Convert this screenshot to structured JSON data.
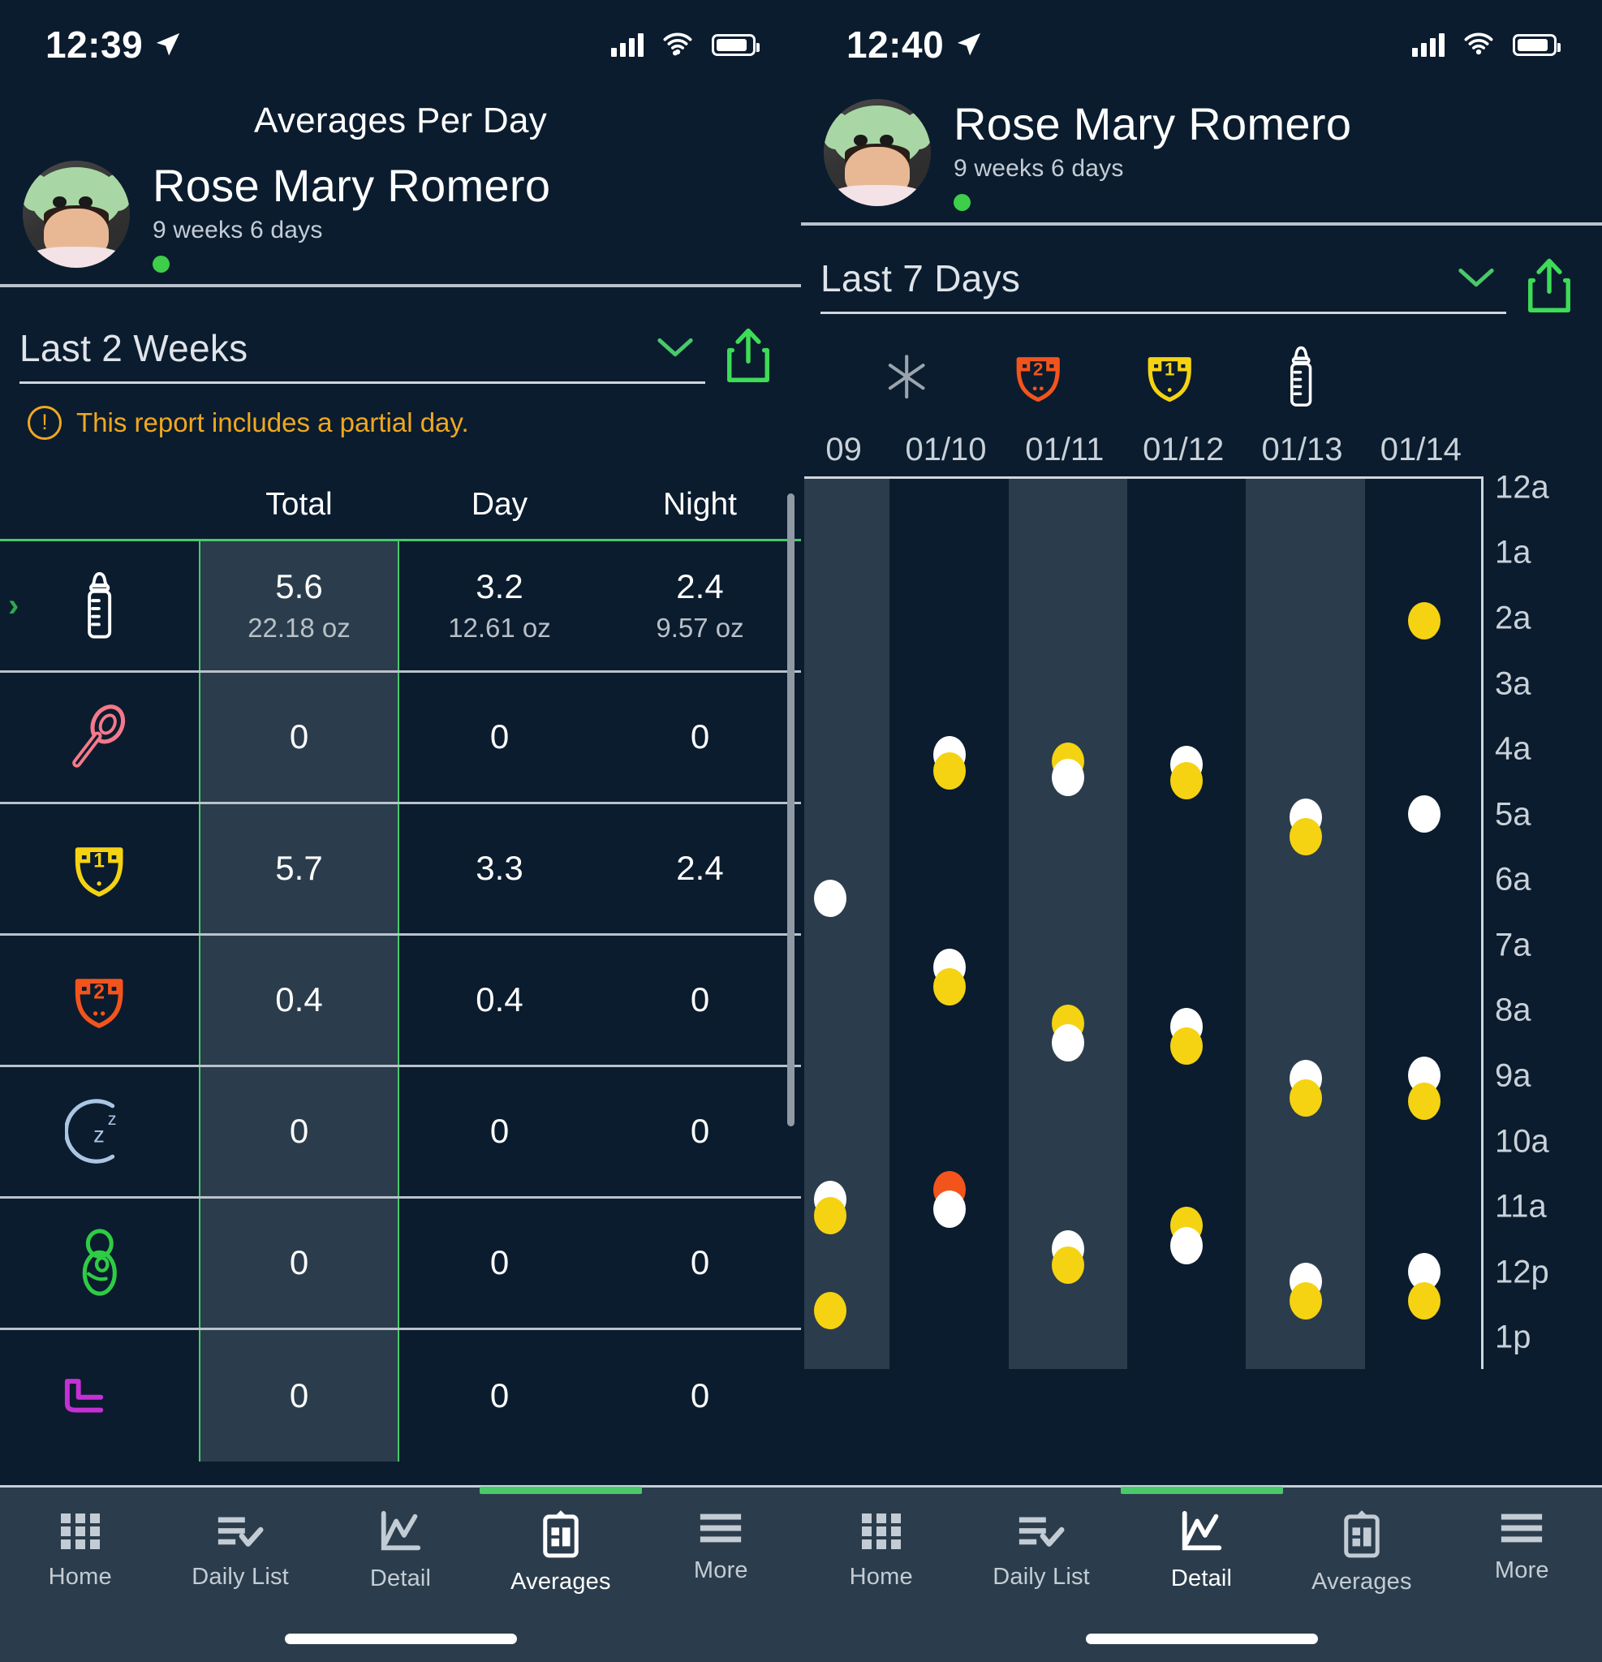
{
  "left": {
    "status": {
      "time": "12:39",
      "location_icon": "location-arrow-icon"
    },
    "page_title": "Averages Per Day",
    "baby": {
      "name": "Rose Mary Romero",
      "age": "9 weeks  6 days",
      "status_dot_color": "#3ece4a"
    },
    "range": {
      "value": "Last 2 Weeks",
      "chevron": "chevron-down-icon",
      "share": "share-icon"
    },
    "warning": {
      "icon": "exclamation-circle-icon",
      "text": "This report includes a partial day."
    },
    "table": {
      "headers": [
        "",
        "Total",
        "Day",
        "Night"
      ],
      "rows": [
        {
          "icon": "bottle-icon",
          "icon_color": "#ffffff",
          "expandable": true,
          "total": "5.6",
          "total_sub": "22.18 oz",
          "day": "3.2",
          "day_sub": "12.61 oz",
          "night": "2.4",
          "night_sub": "9.57 oz"
        },
        {
          "icon": "spoon-icon",
          "icon_color": "#f4798a",
          "expandable": false,
          "total": "0",
          "total_sub": "",
          "day": "0",
          "day_sub": "",
          "night": "0",
          "night_sub": ""
        },
        {
          "icon": "diaper-wet-icon",
          "icon_color": "#f5d312",
          "expandable": false,
          "total": "5.7",
          "total_sub": "",
          "day": "3.3",
          "day_sub": "",
          "night": "2.4",
          "night_sub": ""
        },
        {
          "icon": "diaper-dirty-icon",
          "icon_color": "#f3541c",
          "expandable": false,
          "total": "0.4",
          "total_sub": "",
          "day": "0.4",
          "day_sub": "",
          "night": "0",
          "night_sub": ""
        },
        {
          "icon": "sleep-moon-icon",
          "icon_color": "#aac6e3",
          "expandable": false,
          "total": "0",
          "total_sub": "",
          "day": "0",
          "day_sub": "",
          "night": "0",
          "night_sub": ""
        },
        {
          "icon": "swaddle-icon",
          "icon_color": "#2ecc45",
          "expandable": false,
          "total": "0",
          "total_sub": "",
          "day": "0",
          "day_sub": "",
          "night": "0",
          "night_sub": ""
        },
        {
          "icon": "pump-icon",
          "icon_color": "#c530d6",
          "expandable": false,
          "total": "0",
          "total_sub": "",
          "day": "0",
          "day_sub": "",
          "night": "0",
          "night_sub": ""
        }
      ]
    },
    "tabs": [
      {
        "label": "Home",
        "icon": "grid-icon",
        "active": false
      },
      {
        "label": "Daily List",
        "icon": "list-check-icon",
        "active": false
      },
      {
        "label": "Detail",
        "icon": "line-chart-icon",
        "active": false
      },
      {
        "label": "Averages",
        "icon": "clipboard-chart-icon",
        "active": true
      },
      {
        "label": "More",
        "icon": "hamburger-icon",
        "active": false
      }
    ]
  },
  "right": {
    "status": {
      "time": "12:40",
      "location_icon": "location-arrow-icon"
    },
    "baby": {
      "name": "Rose Mary Romero",
      "age": "9 weeks  6 days",
      "status_dot_color": "#3ece4a"
    },
    "range": {
      "value": "Last 7 Days",
      "chevron": "chevron-down-icon",
      "share": "share-icon"
    },
    "filters": [
      {
        "name": "asterisk-icon",
        "color": "#9aa4ae"
      },
      {
        "name": "diaper-dirty-icon",
        "color": "#f3541c"
      },
      {
        "name": "diaper-wet-icon",
        "color": "#f5d312"
      },
      {
        "name": "bottle-icon",
        "color": "#ffffff"
      }
    ],
    "tabs": [
      {
        "label": "Home",
        "icon": "grid-icon",
        "active": false
      },
      {
        "label": "Daily List",
        "icon": "list-check-icon",
        "active": false
      },
      {
        "label": "Detail",
        "icon": "line-chart-icon",
        "active": true
      },
      {
        "label": "Averages",
        "icon": "clipboard-chart-icon",
        "active": false
      },
      {
        "label": "More",
        "icon": "hamburger-icon",
        "active": false
      }
    ]
  },
  "chart_data": {
    "type": "scatter",
    "title": "",
    "xlabel": "",
    "ylabel": "",
    "categories": [
      "01/09",
      "01/10",
      "01/11",
      "01/12",
      "01/13",
      "01/14"
    ],
    "partial_first_label": "09",
    "ytick_labels": [
      "12a",
      "1a",
      "2a",
      "3a",
      "4a",
      "5a",
      "6a",
      "7a",
      "8a",
      "9a",
      "10a",
      "11a",
      "12p",
      "1p"
    ],
    "ylim_hours": [
      0,
      13
    ],
    "grid": false,
    "legend": "none",
    "series": [
      {
        "name": "bottle",
        "color": "#ffffff"
      },
      {
        "name": "diaper-wet",
        "color": "#f5d312"
      },
      {
        "name": "diaper-dirty",
        "color": "#f3541c"
      }
    ],
    "points": [
      {
        "date": "01/09",
        "hour": 6.25,
        "color": "#ffffff",
        "series": "bottle"
      },
      {
        "date": "01/09",
        "hour": 10.85,
        "color": "#ffffff",
        "series": "bottle"
      },
      {
        "date": "01/09",
        "hour": 11.1,
        "color": "#f5d312",
        "series": "diaper-wet"
      },
      {
        "date": "01/09",
        "hour": 12.55,
        "color": "#f5d312",
        "series": "diaper-wet"
      },
      {
        "date": "01/10",
        "hour": 4.05,
        "color": "#ffffff",
        "series": "bottle"
      },
      {
        "date": "01/10",
        "hour": 4.3,
        "color": "#f5d312",
        "series": "diaper-wet"
      },
      {
        "date": "01/10",
        "hour": 7.3,
        "color": "#ffffff",
        "series": "bottle"
      },
      {
        "date": "01/10",
        "hour": 7.6,
        "color": "#f5d312",
        "series": "diaper-wet"
      },
      {
        "date": "01/10",
        "hour": 10.7,
        "color": "#f3541c",
        "series": "diaper-dirty"
      },
      {
        "date": "01/10",
        "hour": 11.0,
        "color": "#ffffff",
        "series": "bottle"
      },
      {
        "date": "01/11",
        "hour": 4.15,
        "color": "#f5d312",
        "series": "diaper-wet"
      },
      {
        "date": "01/11",
        "hour": 4.4,
        "color": "#ffffff",
        "series": "bottle"
      },
      {
        "date": "01/11",
        "hour": 8.15,
        "color": "#f5d312",
        "series": "diaper-wet"
      },
      {
        "date": "01/11",
        "hour": 8.45,
        "color": "#ffffff",
        "series": "bottle"
      },
      {
        "date": "01/11",
        "hour": 11.6,
        "color": "#ffffff",
        "series": "bottle"
      },
      {
        "date": "01/11",
        "hour": 11.85,
        "color": "#f5d312",
        "series": "diaper-wet"
      },
      {
        "date": "01/12",
        "hour": 4.2,
        "color": "#ffffff",
        "series": "bottle"
      },
      {
        "date": "01/12",
        "hour": 4.45,
        "color": "#f5d312",
        "series": "diaper-wet"
      },
      {
        "date": "01/12",
        "hour": 8.2,
        "color": "#ffffff",
        "series": "bottle"
      },
      {
        "date": "01/12",
        "hour": 8.5,
        "color": "#f5d312",
        "series": "diaper-wet"
      },
      {
        "date": "01/12",
        "hour": 11.25,
        "color": "#f5d312",
        "series": "diaper-wet"
      },
      {
        "date": "01/12",
        "hour": 11.55,
        "color": "#ffffff",
        "series": "bottle"
      },
      {
        "date": "01/13",
        "hour": 5.0,
        "color": "#ffffff",
        "series": "bottle"
      },
      {
        "date": "01/13",
        "hour": 5.3,
        "color": "#f5d312",
        "series": "diaper-wet"
      },
      {
        "date": "01/13",
        "hour": 9.0,
        "color": "#ffffff",
        "series": "bottle"
      },
      {
        "date": "01/13",
        "hour": 9.3,
        "color": "#f5d312",
        "series": "diaper-wet"
      },
      {
        "date": "01/13",
        "hour": 12.1,
        "color": "#ffffff",
        "series": "bottle"
      },
      {
        "date": "01/13",
        "hour": 12.4,
        "color": "#f5d312",
        "series": "diaper-wet"
      },
      {
        "date": "01/14",
        "hour": 2.0,
        "color": "#f5d312",
        "series": "diaper-wet"
      },
      {
        "date": "01/14",
        "hour": 4.95,
        "color": "#ffffff",
        "series": "bottle"
      },
      {
        "date": "01/14",
        "hour": 8.95,
        "color": "#ffffff",
        "series": "bottle"
      },
      {
        "date": "01/14",
        "hour": 9.35,
        "color": "#f5d312",
        "series": "diaper-wet"
      },
      {
        "date": "01/14",
        "hour": 11.95,
        "color": "#ffffff",
        "series": "bottle"
      },
      {
        "date": "01/14",
        "hour": 12.4,
        "color": "#f5d312",
        "series": "diaper-wet"
      }
    ]
  }
}
